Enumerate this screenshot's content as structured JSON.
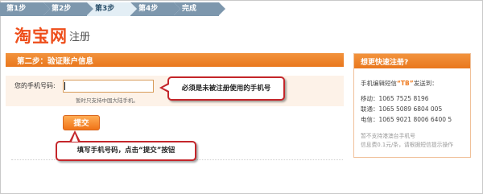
{
  "steps": [
    {
      "label": "第1步"
    },
    {
      "label": "第2步"
    },
    {
      "label": "第3步"
    },
    {
      "label": "第4步"
    },
    {
      "label": "完成"
    }
  ],
  "logo": {
    "name": "淘宝网",
    "subtitle": "注册"
  },
  "section": {
    "title": "第二步：验证账户信息"
  },
  "form": {
    "phone_label": "您的手机号码:",
    "phone_value": "",
    "hint": "暂时只支持中国大陆手机。",
    "submit_label": "提交"
  },
  "callouts": {
    "phone_tip": "必须是未被注册使用的手机号",
    "submit_tip": "填写手机号码，点击“提交”按钮"
  },
  "side": {
    "title": "想更快速注册?",
    "intro_prefix": "手机编辑短信",
    "intro_code": "“TB”",
    "intro_suffix": "发送到：",
    "mobile": "移动：1065 7525 8196",
    "unicom": "联通：1065 5089 6804 005",
    "telecom": "电信：1065 9021 8006 6400 5",
    "note1": "暂不支持港澳台手机号",
    "note2": "信息费0.1元/条，请根据短信提示操作"
  },
  "colors": {
    "accent": "#e9771d",
    "logo": "#ee4e1b",
    "callout_border": "#c4262b",
    "step": "#7d97ad"
  }
}
